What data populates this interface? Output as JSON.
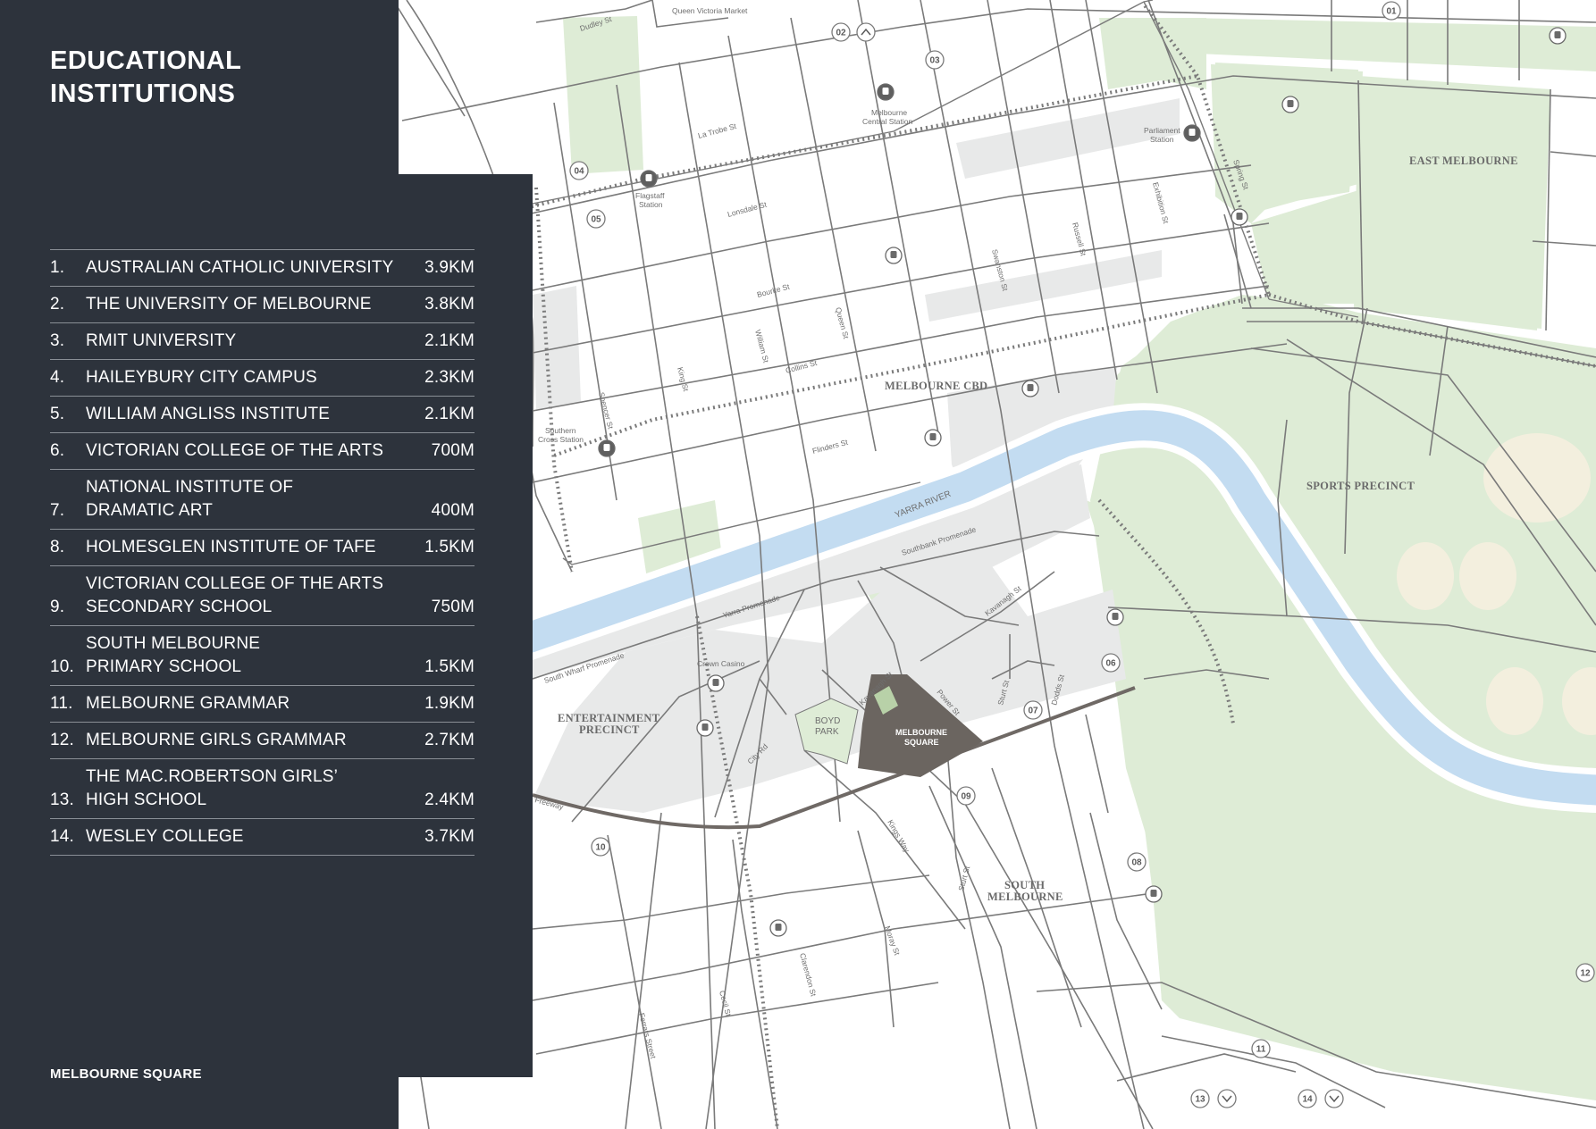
{
  "panel": {
    "title": "EDUCATIONAL\nINSTITUTIONS",
    "footer": "MELBOURNE SQUARE",
    "bg_color": "#2d333c"
  },
  "institutions": [
    {
      "num": "1.",
      "name": "AUSTRALIAN CATHOLIC UNIVERSITY",
      "dist": "3.9KM"
    },
    {
      "num": "2.",
      "name": "THE UNIVERSITY OF MELBOURNE",
      "dist": "3.8KM"
    },
    {
      "num": "3.",
      "name": "RMIT UNIVERSITY",
      "dist": "2.1KM"
    },
    {
      "num": "4.",
      "name": "HAILEYBURY CITY CAMPUS",
      "dist": "2.3KM"
    },
    {
      "num": "5.",
      "name": "WILLIAM ANGLISS INSTITUTE",
      "dist": "2.1KM"
    },
    {
      "num": "6.",
      "name": "VICTORIAN COLLEGE OF THE ARTS",
      "dist": "700M"
    },
    {
      "num": "7.",
      "name": "NATIONAL INSTITUTE OF\nDRAMATIC ART",
      "dist": "400M"
    },
    {
      "num": "8.",
      "name": "HOLMESGLEN INSTITUTE OF TAFE",
      "dist": "1.5KM"
    },
    {
      "num": "9.",
      "name": "VICTORIAN COLLEGE OF THE ARTS\nSECONDARY SCHOOL",
      "dist": "750M"
    },
    {
      "num": "10.",
      "name": "SOUTH MELBOURNE\nPRIMARY SCHOOL",
      "dist": "1.5KM"
    },
    {
      "num": "11.",
      "name": "MELBOURNE GRAMMAR",
      "dist": "1.9KM"
    },
    {
      "num": "12.",
      "name": "MELBOURNE GIRLS GRAMMAR",
      "dist": "2.7KM"
    },
    {
      "num": "13.",
      "name": "THE MAC.ROBERTSON GIRLS’\nHIGH SCHOOL",
      "dist": "2.4KM"
    },
    {
      "num": "14.",
      "name": "WESLEY COLLEGE",
      "dist": "3.7KM"
    }
  ],
  "map": {
    "districts": {
      "cbd": "MELBOURNE CBD",
      "east": "EAST MELBOURNE",
      "sports": "SPORTS PRECINCT",
      "ent1": "ENTERTAINMENT",
      "ent2": "PRECINCT",
      "sm1": "SOUTH",
      "sm2": "MELBOURNE",
      "bp1": "BOYD",
      "bp2": "PARK",
      "ms1": "MELBOURNE",
      "ms2": "SQUARE"
    },
    "river": "YARRA RIVER",
    "streets": {
      "dudley": "Dudley St",
      "qvm": "Queen Victoria Market",
      "latrobe": "La Trobe St",
      "lonsdale": "Lonsdale St",
      "bourke": "Bourke St",
      "collins": "Collins St",
      "flinders": "Flinders St",
      "king": "King St",
      "william": "William St",
      "queen": "Queen St",
      "spencer": "Spencer St",
      "swanston": "Swanston St",
      "russell": "Russell St",
      "exhibition": "Exhibition St",
      "spring": "Spring St",
      "southbank": "Southbank Promenade",
      "yarraprom": "Yarra Promenade",
      "southwharf": "South Wharf Promenade",
      "kavanagh1": "Kavanagh St",
      "kavanagh2": "Kavanagh St",
      "power": "Power St",
      "sturt1": "Sturt St",
      "sturt2": "Sturt St",
      "dodds": "Dodds St",
      "cityrd": "City Rd",
      "kings": "Kings Way",
      "freeway": "Freeway",
      "moray": "Moray St",
      "clarendon": "Clarendon St",
      "cecil": "Cecil St",
      "ferrars": "Ferrars Street",
      "casino": "Crown Casino"
    },
    "stations": {
      "flagstaff1": "Flagstaff",
      "flagstaff2": "Station",
      "central1": "Melbourne",
      "central2": "Central Station",
      "parliament1": "Parliament",
      "parliament2": "Station",
      "southern1": "Southern",
      "southern2": "Cross Station"
    },
    "markers": [
      "01",
      "02",
      "03",
      "04",
      "05",
      "06",
      "07",
      "08",
      "09",
      "10",
      "11",
      "12",
      "13",
      "14"
    ],
    "colors": {
      "park": "#deecd6",
      "river": "#c3dcf1",
      "road": "#787878",
      "precinct": "#e8e9e9",
      "site": "#6b6560",
      "oval": "#f3efde"
    }
  }
}
